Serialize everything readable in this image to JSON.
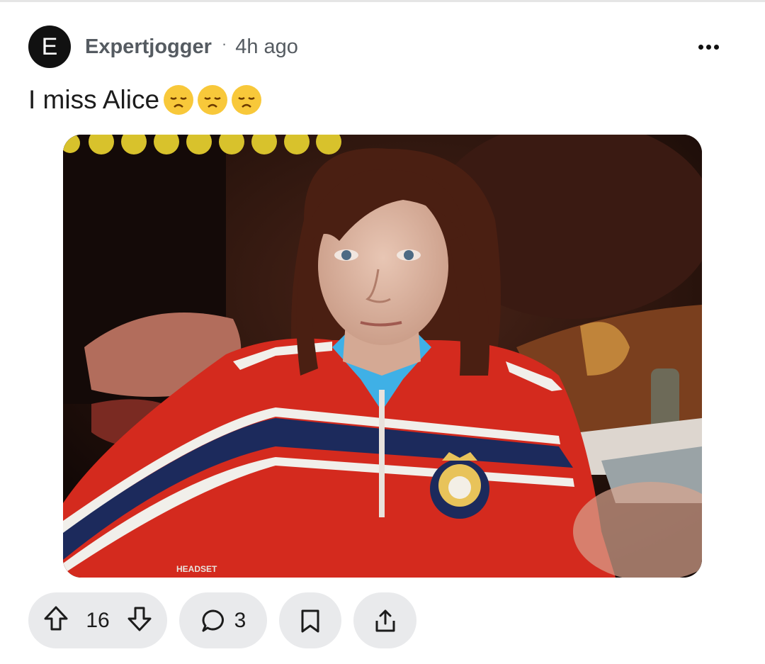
{
  "post": {
    "avatar_letter": "E",
    "author": "Expertjogger",
    "separator": "·",
    "time": "4h ago",
    "title": "I miss Alice",
    "title_emojis": [
      "disappointed-face-icon",
      "disappointed-face-icon",
      "disappointed-face-icon"
    ],
    "media": {
      "overlay_text": "HEADSET",
      "emoji_strip_count": 9
    }
  },
  "actions": {
    "vote_count": "16",
    "comment_count": "3"
  },
  "colors": {
    "avatar_bg": "#111111",
    "pill_bg": "#e9eaec",
    "emoji_yellow": "#f8c83a",
    "sweater_red": "#d42a1e",
    "sweater_navy": "#1c2a5c",
    "collar_blue": "#3fb0e6"
  }
}
